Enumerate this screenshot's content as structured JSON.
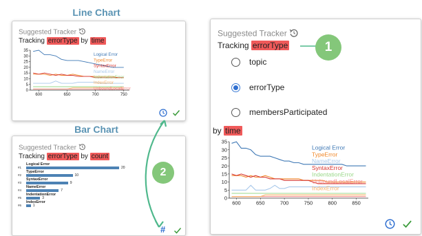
{
  "headings": {
    "line": "Line Chart",
    "bar": "Bar Chart"
  },
  "suggested_label": "Suggested Tracker",
  "line_card": {
    "tracking_prefix": "Tracking",
    "field": "errorType",
    "by_word": "by",
    "measure": "time"
  },
  "bar_card": {
    "tracking_prefix": "Tracking",
    "field": "errorType",
    "by_word": "by",
    "measure": "count",
    "hash_icon_text": "#"
  },
  "big_card": {
    "tracking_prefix": "Tracking",
    "field": "errorType",
    "options": [
      {
        "label": "topic",
        "selected": false
      },
      {
        "label": "errorType",
        "selected": true
      },
      {
        "label": "membersParticipated",
        "selected": false
      }
    ],
    "by_word": "by",
    "measure": "time"
  },
  "badges": {
    "one": "1",
    "two": "2"
  },
  "colors": {
    "accent": "#2f6fd0",
    "highlight": "#f05a5a",
    "badge": "#84c77a",
    "check": "#3a9b3a",
    "arrow": "#4fb88c",
    "bar": "#4d82b4",
    "heading": "#5a93b3"
  },
  "icons": {
    "history": "history-icon",
    "clock": "clock-icon",
    "check": "check-icon",
    "hash": "hash-icon"
  },
  "chart_data": [
    {
      "type": "line",
      "name": "small-line",
      "x": [
        590,
        600,
        610,
        620,
        630,
        640,
        650,
        660,
        670,
        680,
        690,
        700,
        710,
        720,
        730,
        740,
        750
      ],
      "ylim": [
        0,
        35
      ],
      "xlim": [
        585,
        760
      ],
      "yticks": [
        0,
        5,
        10,
        15,
        20,
        25,
        30,
        35
      ],
      "xticks": [
        600,
        650,
        700,
        750
      ],
      "series": [
        {
          "name": "Logical Error",
          "color": "#3e78b5",
          "values": [
            34,
            35,
            31,
            31,
            30,
            27,
            26,
            26,
            26,
            25,
            24,
            23,
            22,
            21,
            20,
            20,
            20
          ]
        },
        {
          "name": "TypeError",
          "color": "#f0882a",
          "values": [
            14,
            14,
            14,
            13,
            14,
            13,
            13,
            14,
            13,
            12,
            12,
            12,
            12,
            12,
            12,
            11,
            11
          ]
        },
        {
          "name": "SyntaxError",
          "color": "#d6332d",
          "values": [
            15,
            14,
            15,
            14,
            13,
            14,
            13,
            13,
            12,
            12,
            12,
            11,
            11,
            11,
            11,
            11,
            11
          ]
        },
        {
          "name": "NameError",
          "color": "#a8c8ea",
          "values": [
            6,
            6,
            6,
            6,
            8,
            6,
            6,
            6,
            7,
            7,
            7,
            7,
            6,
            6,
            6,
            6,
            6
          ]
        },
        {
          "name": "IndentationError",
          "color": "#9bd88a",
          "values": [
            3,
            3,
            3,
            3,
            3,
            3,
            3,
            3,
            3,
            3,
            3,
            3,
            3,
            3,
            3,
            3,
            3
          ]
        },
        {
          "name": "IndexError",
          "color": "#f7b36a",
          "values": [
            1,
            1,
            1,
            1,
            1,
            1,
            1,
            2,
            2,
            2,
            2,
            2,
            2,
            2,
            2,
            2,
            2
          ]
        },
        {
          "name": "UnboundLocalError",
          "color": "#f28a8a",
          "values": [
            1,
            1,
            1,
            1,
            1,
            1,
            1,
            1,
            1,
            1,
            1,
            1,
            1,
            1,
            1,
            1,
            1
          ]
        }
      ],
      "legend": [
        "Logical Error",
        "TypeError",
        "SyntaxError",
        "NameError",
        "IndentationError",
        "IndexError",
        "UnboundLocalError"
      ]
    },
    {
      "type": "bar",
      "name": "small-bar",
      "categories": [
        "Logical Error",
        "TypeError",
        "SyntaxError",
        "NameError",
        "IndentationError",
        "IndexError"
      ],
      "indices": [
        "#1",
        "#2",
        "#3",
        "#4",
        "#5",
        "#6"
      ],
      "values": [
        20,
        10,
        9,
        7,
        3,
        1
      ],
      "xlim": [
        0,
        20
      ]
    },
    {
      "type": "line",
      "name": "big-line",
      "x": [
        590,
        600,
        610,
        620,
        630,
        640,
        650,
        660,
        670,
        680,
        690,
        700,
        710,
        720,
        730,
        740,
        750,
        760,
        770,
        780,
        790,
        800,
        810,
        820,
        830,
        840,
        850,
        860,
        870
      ],
      "ylim": [
        0,
        35
      ],
      "xlim": [
        585,
        875
      ],
      "yticks": [
        0,
        5,
        10,
        15,
        20,
        25,
        30,
        35
      ],
      "xticks": [
        600,
        650,
        700,
        750,
        800,
        850
      ],
      "series": [
        {
          "name": "Logical Error",
          "color": "#3e78b5",
          "values": [
            34,
            35,
            31,
            31,
            30,
            27,
            26,
            26,
            26,
            25,
            24,
            23,
            23,
            22,
            22,
            21,
            21,
            21,
            21,
            21,
            21,
            21,
            21,
            21,
            20,
            20,
            20,
            20,
            20
          ]
        },
        {
          "name": "TypeError",
          "color": "#f0882a",
          "values": [
            14,
            14,
            14,
            13,
            14,
            13,
            13,
            14,
            13,
            12,
            12,
            12,
            12,
            12,
            12,
            11,
            11,
            11,
            11,
            11,
            10,
            10,
            10,
            10,
            10,
            10,
            10,
            10,
            10
          ]
        },
        {
          "name": "NameError",
          "color": "#a8c8ea",
          "values": [
            5,
            5,
            5,
            5,
            8,
            5,
            5,
            5,
            6,
            8,
            6,
            6,
            7,
            7,
            7,
            7,
            7,
            7,
            7,
            7,
            7,
            7,
            7,
            7,
            7,
            7,
            7,
            7,
            7
          ]
        },
        {
          "name": "SyntaxError",
          "color": "#d6332d",
          "values": [
            15,
            14,
            15,
            14,
            13,
            14,
            13,
            13,
            12,
            12,
            12,
            11,
            11,
            11,
            11,
            11,
            11,
            10,
            9,
            9,
            9,
            9,
            9,
            9,
            9,
            9,
            9,
            9,
            9
          ]
        },
        {
          "name": "IndentationError",
          "color": "#9bd88a",
          "values": [
            3,
            3,
            3,
            3,
            3,
            3,
            3,
            3,
            3,
            3,
            3,
            3,
            3,
            3,
            3,
            3,
            3,
            3,
            3,
            3,
            3,
            3,
            3,
            3,
            3,
            3,
            3,
            3,
            3
          ]
        },
        {
          "name": "UnboundLocalError",
          "color": "#f28a8a",
          "values": [
            1,
            1,
            1,
            1,
            1,
            1,
            1,
            1,
            1,
            1,
            1,
            1,
            1,
            1,
            1,
            1,
            1,
            1,
            1,
            1,
            1,
            1,
            1,
            1,
            1,
            1,
            1,
            1,
            1
          ]
        },
        {
          "name": "IndexError",
          "color": "#f7b36a",
          "values": [
            1,
            1,
            1,
            1,
            1,
            1,
            1,
            2,
            2,
            2,
            2,
            2,
            2,
            2,
            2,
            2,
            2,
            2,
            2,
            2,
            2,
            2,
            2,
            2,
            2,
            2,
            2,
            2,
            2
          ]
        }
      ],
      "legend": [
        "Logical Error",
        "TypeError",
        "NameError",
        "SyntaxError",
        "IndentationError",
        "UnboundLocalError",
        "IndexError"
      ]
    }
  ]
}
